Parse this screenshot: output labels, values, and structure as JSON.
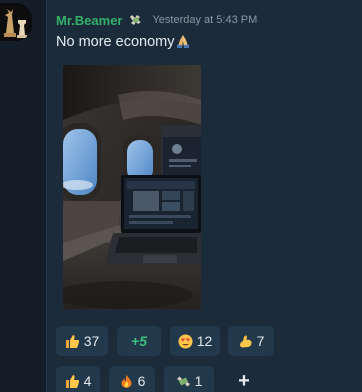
{
  "message": {
    "author": "Mr.Beamer",
    "author_badge_icon": "money-with-wings-icon",
    "timestamp": "Yesterday at 5:43 PM",
    "text": "No more economy",
    "text_emoji_icon": "folded-hands-icon",
    "attachment": {
      "kind": "image",
      "icon": "airplane-cabin-laptop-photo"
    }
  },
  "reactions": [
    {
      "icon": "thumbs-up-icon",
      "count": "37"
    },
    {
      "icon": "",
      "count": "+5"
    },
    {
      "icon": "heart-eyes-face-icon",
      "count": "12"
    },
    {
      "icon": "flexed-biceps-icon",
      "count": "7"
    },
    {
      "icon": "thumbs-up-icon",
      "count": "4"
    },
    {
      "icon": "fire-icon",
      "count": "6"
    },
    {
      "icon": "money-with-wings-icon",
      "count": "1"
    },
    {
      "icon": "plus-icon",
      "label": "+"
    }
  ],
  "colors": {
    "author": "#35b06a",
    "timestamp": "#8b98a5",
    "message_background": "#1b2b3a",
    "reaction_background": "#22384b",
    "more_count": "#3ec07d"
  }
}
